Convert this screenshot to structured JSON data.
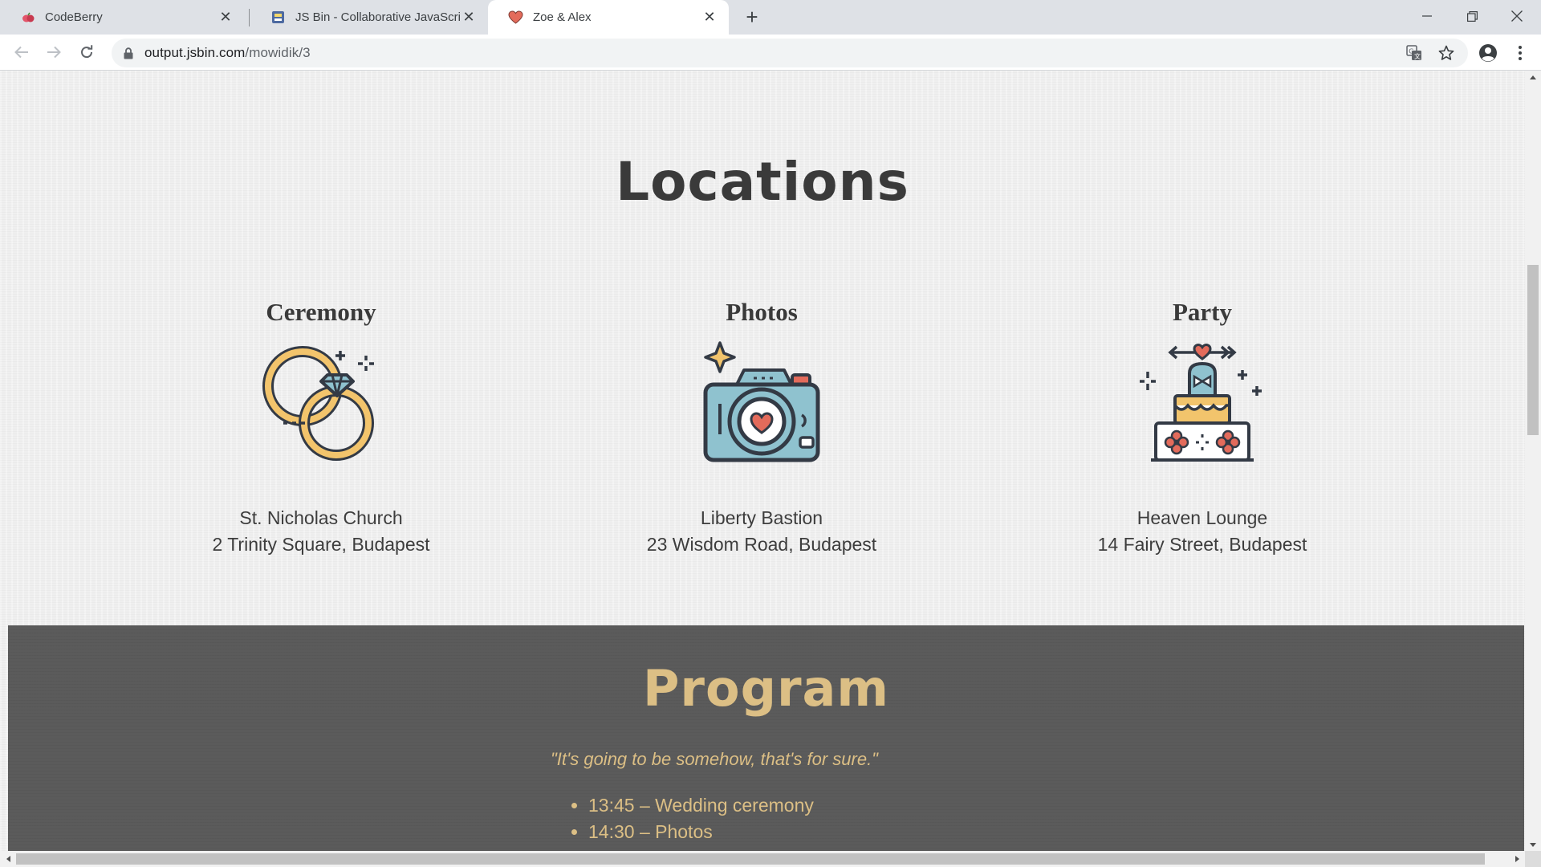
{
  "browser": {
    "tabs": [
      {
        "title": "CodeBerry",
        "favicon": "codeberry-icon",
        "active": false
      },
      {
        "title": "JS Bin - Collaborative JavaScript Debugging",
        "favicon": "jsbin-icon",
        "active": false
      },
      {
        "title": "Zoe & Alex",
        "favicon": "heart-icon",
        "active": true
      }
    ],
    "url_host": "output.jsbin.com",
    "url_path": "/mowidik/3"
  },
  "page": {
    "locations_title": "Locations",
    "locations": [
      {
        "heading": "Ceremony",
        "icon": "wedding-rings-icon",
        "venue": "St. Nicholas Church",
        "address": "2 Trinity Square, Budapest"
      },
      {
        "heading": "Photos",
        "icon": "camera-icon",
        "venue": "Liberty Bastion",
        "address": "23 Wisdom Road, Budapest"
      },
      {
        "heading": "Party",
        "icon": "wedding-cake-icon",
        "venue": "Heaven Lounge",
        "address": "14 Fairy Street, Budapest"
      }
    ],
    "program": {
      "title": "Program",
      "quote": "\"It's going to be somehow, that's for sure.\"",
      "items": [
        "13:45 – Wedding ceremony",
        "14:30 – Photos"
      ]
    }
  },
  "colors": {
    "heading": "#3a3a3a",
    "accent_gold": "#dcbf85",
    "program_bg": "#5b5b5b",
    "icon_blue": "#8fc2cf",
    "icon_red": "#e36b5b",
    "icon_yellow": "#f2c46c",
    "icon_dark": "#333a45"
  }
}
